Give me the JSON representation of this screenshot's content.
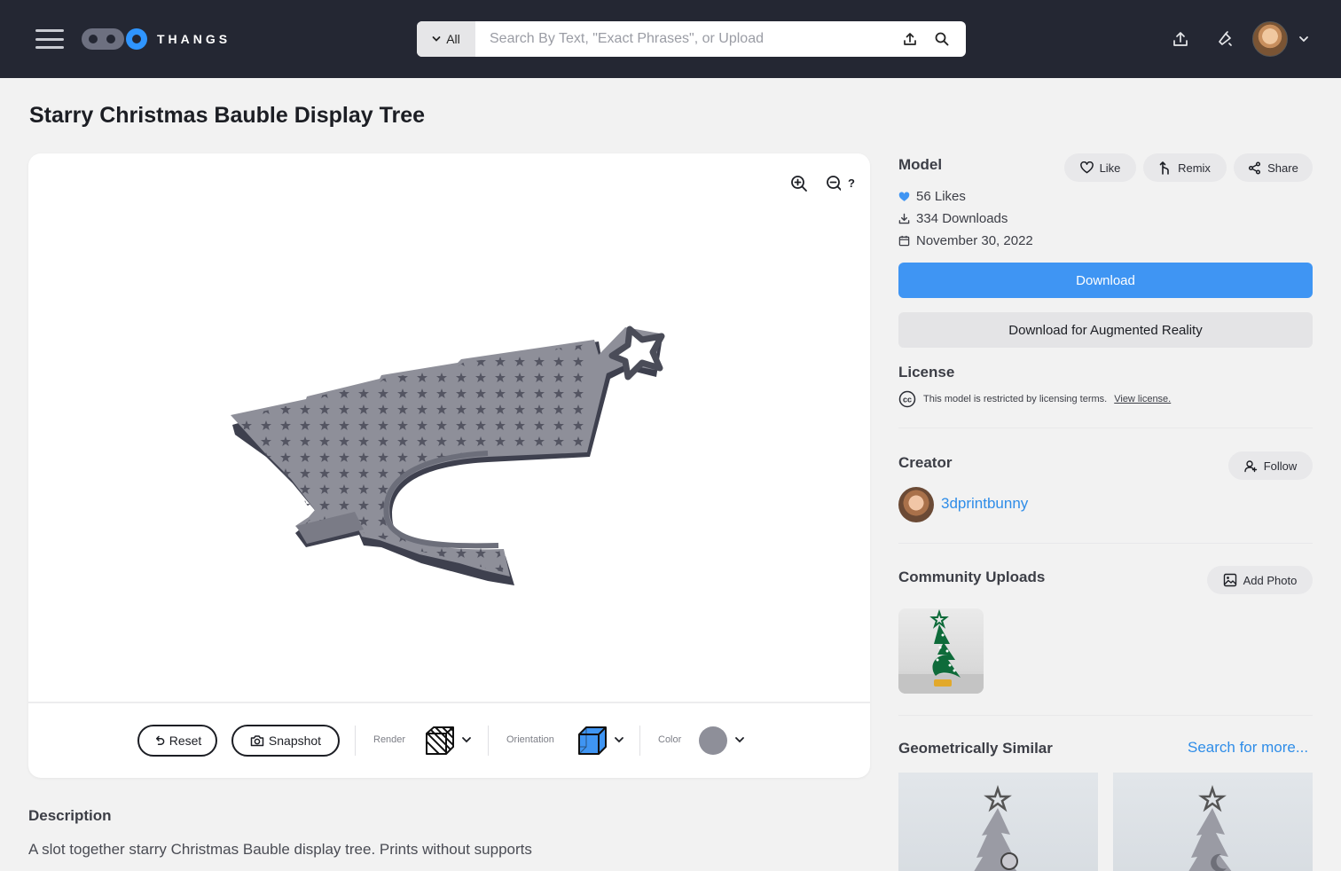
{
  "header": {
    "brand": "THANGS",
    "search": {
      "scope": "All",
      "placeholder": "Search By Text, \"Exact Phrases\", or Upload"
    }
  },
  "page": {
    "title": "Starry Christmas Bauble Display Tree"
  },
  "viewer": {
    "help": "?",
    "toolbar": {
      "reset_label": "Reset",
      "snapshot_label": "Snapshot",
      "render_label": "Render",
      "orientation_label": "Orientation",
      "color_label": "Color"
    },
    "model_color": "#8e8f99"
  },
  "description": {
    "title": "Description",
    "text": "A slot together starry Christmas Bauble display tree. Prints without supports"
  },
  "model": {
    "title": "Model",
    "actions": {
      "like": "Like",
      "remix": "Remix",
      "share": "Share"
    },
    "stats": {
      "likes": "56 Likes",
      "downloads": "334 Downloads",
      "date": "November 30, 2022"
    },
    "download_label": "Download",
    "ar_label": "Download for Augmented Reality"
  },
  "license": {
    "title": "License",
    "text": "This model is restricted by licensing terms.",
    "link": "View license."
  },
  "creator": {
    "title": "Creator",
    "follow": "Follow",
    "name": "3dprintbunny"
  },
  "community": {
    "title": "Community Uploads",
    "add_photo": "Add Photo"
  },
  "similar": {
    "title": "Geometrically Similar",
    "search_more": "Search for more..."
  },
  "colors": {
    "header_bg": "#242733",
    "accent": "#3f95f3",
    "link": "#2f8de8"
  }
}
